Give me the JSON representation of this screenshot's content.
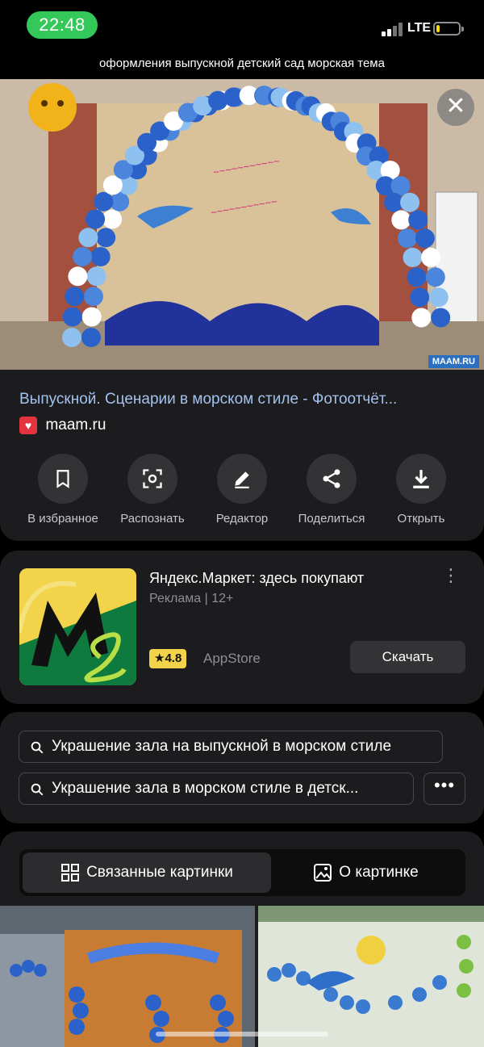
{
  "status_bar": {
    "time": "22:48",
    "network": "LTE",
    "battery_level": 0.15
  },
  "query_title": "оформления выпускной детский сад морская тема",
  "hero": {
    "watermark": "MAAM.RU"
  },
  "result": {
    "title": "Выпускной. Сценарии в морском стиле - Фотоотчёт...",
    "domain": "maam.ru"
  },
  "actions": [
    {
      "label": "В избранное",
      "icon": "bookmark-icon"
    },
    {
      "label": "Распознать",
      "icon": "scan-icon"
    },
    {
      "label": "Редактор",
      "icon": "pencil-icon"
    },
    {
      "label": "Поделиться",
      "icon": "share-icon"
    },
    {
      "label": "Открыть",
      "icon": "download-icon"
    }
  ],
  "ad": {
    "app_name": "Яндекс.Маркет: здесь покупают",
    "ad_label": "Реклама",
    "age": "12+",
    "rating": "4.8",
    "store": "AppStore",
    "download_label": "Скачать"
  },
  "suggestions": [
    "Украшение зала на выпускной в морском стиле",
    "Украшение зала в морском стиле в детск..."
  ],
  "tabs": [
    {
      "label": "Связанные картинки",
      "active": true
    },
    {
      "label": "О картинке",
      "active": false
    }
  ],
  "colors": {
    "accent_green": "#34c759",
    "link_blue": "#a3c2ee",
    "rating_yellow": "#f3d34a"
  }
}
